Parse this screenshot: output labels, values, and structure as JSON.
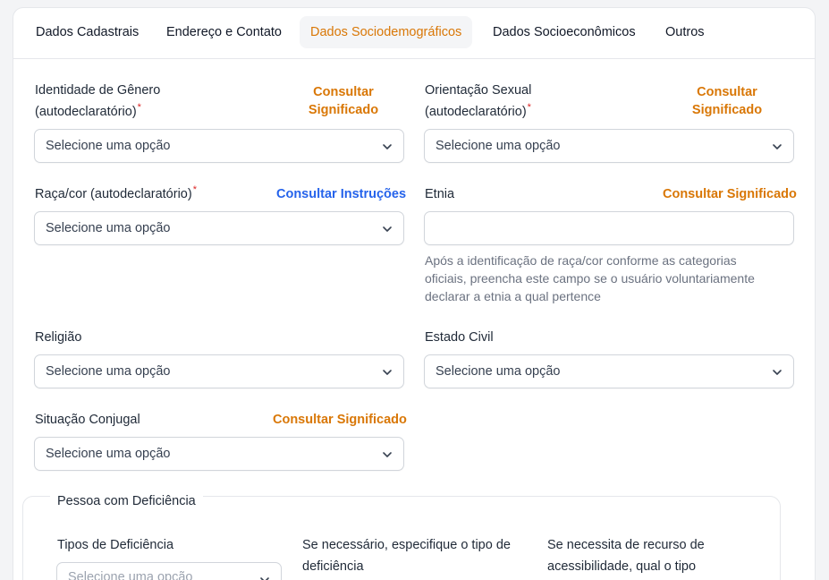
{
  "tabs": [
    {
      "label": "Dados Cadastrais",
      "active": false
    },
    {
      "label": "Endereço e Contato",
      "active": false
    },
    {
      "label": "Dados Sociodemográficos",
      "active": true
    },
    {
      "label": "Dados Socioeconômicos",
      "active": false
    },
    {
      "label": "Outros",
      "active": false
    }
  ],
  "colors": {
    "accent": "#d97706",
    "link_blue": "#2563eb",
    "required": "#dc2626"
  },
  "fields": {
    "gender": {
      "label_line1": "Identidade de Gênero",
      "label_line2": "(autodeclaratório)",
      "required": "*",
      "help_line1": "Consultar",
      "help_line2": "Significado",
      "placeholder": "Selecione uma opção"
    },
    "orientation": {
      "label_line1": "Orientação Sexual",
      "label_line2": "(autodeclaratório)",
      "required": "*",
      "help_line1": "Consultar",
      "help_line2": "Significado",
      "placeholder": "Selecione uma opção"
    },
    "race": {
      "label": "Raça/cor (autodeclaratório)",
      "required": "*",
      "help": "Consultar Instruções",
      "placeholder": "Selecione uma opção"
    },
    "ethnicity": {
      "label": "Etnia",
      "help": "Consultar Significado",
      "value": "",
      "hint_line1": "Após a identificação de raça/cor conforme as categorias",
      "hint_line2": "oficiais, preencha este campo se o usuário voluntariamente",
      "hint_line3": "declarar a etnia a qual pertence"
    },
    "religion": {
      "label": "Religião",
      "placeholder": "Selecione uma opção"
    },
    "marital": {
      "label": "Estado Civil",
      "placeholder": "Selecione uma opção"
    },
    "conjugal": {
      "label": "Situação Conjugal",
      "help": "Consultar Significado",
      "placeholder": "Selecione uma opção"
    }
  },
  "disability": {
    "legend": "Pessoa com Deficiência",
    "types_label": "Tipos de Deficiência",
    "types_placeholder": "Selecione uma opção",
    "specify_label_line1": "Se necessário, especifique o tipo de",
    "specify_label_line2": "deficiência",
    "resource_label_line1": "Se necessita de recurso de",
    "resource_label_line2": "acessibilidade, qual o tipo"
  },
  "icons": {
    "help": "question-circle-icon",
    "dropdown": "chevron-down-icon"
  }
}
